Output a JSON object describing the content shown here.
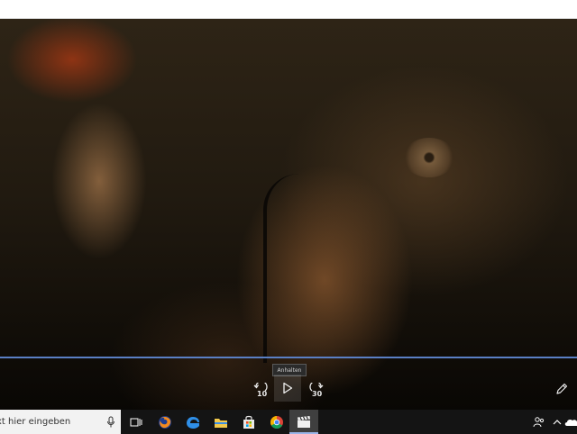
{
  "player": {
    "tooltip": "Anhalten",
    "skip_back_seconds": "10",
    "skip_forward_seconds": "30",
    "progress": 0.0
  },
  "taskbar": {
    "search_placeholder": "xt hier eingeben",
    "icons": [
      "task-view-icon",
      "firefox-icon",
      "edge-icon",
      "file-explorer-icon",
      "store-icon",
      "chrome-icon",
      "movies-tv-icon"
    ]
  },
  "tray": {
    "icons": [
      "people-icon",
      "chevron-up-icon",
      "onedrive-icon"
    ]
  },
  "colors": {
    "seek_track": "#5a7fc4",
    "taskbar_bg": "#141414",
    "active_indicator": "#9ab5e8"
  }
}
